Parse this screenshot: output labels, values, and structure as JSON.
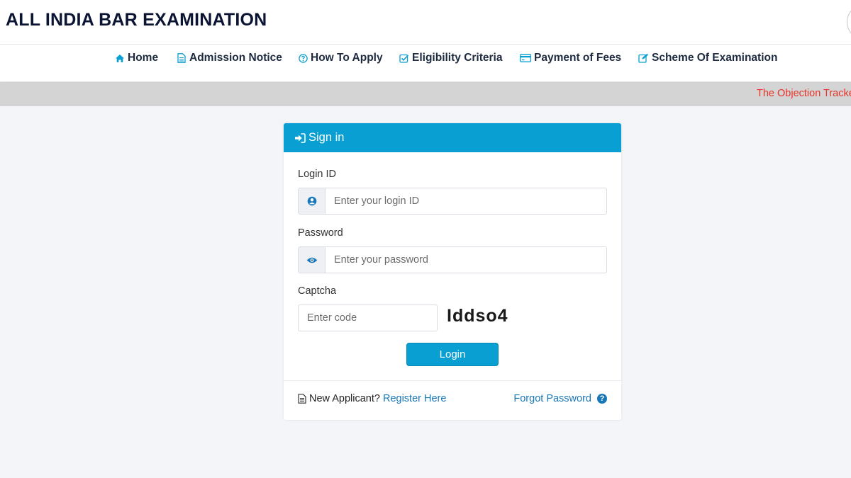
{
  "site": {
    "title": "ALL INDIA BAR EXAMINATION"
  },
  "nav": {
    "items": [
      {
        "label": "Home",
        "icon": "home-icon"
      },
      {
        "label": "Admission Notice",
        "icon": "document-icon"
      },
      {
        "label": "How To Apply",
        "icon": "question-circle-icon"
      },
      {
        "label": "Eligibility Criteria",
        "icon": "check-square-icon"
      },
      {
        "label": "Payment of Fees",
        "icon": "credit-card-icon"
      },
      {
        "label": "Scheme Of Examination",
        "icon": "edit-icon"
      }
    ]
  },
  "ticker": {
    "text": "The Objection Tracke"
  },
  "signin": {
    "title": "Sign in",
    "login_label": "Login ID",
    "login_placeholder": "Enter your login ID",
    "password_label": "Password",
    "password_placeholder": "Enter your password",
    "captcha_label": "Captcha",
    "captcha_placeholder": "Enter code",
    "captcha_code": "Iddso4",
    "login_button": "Login",
    "new_applicant_text": "New Applicant?",
    "register_link": "Register Here",
    "forgot_link": "Forgot Password"
  },
  "colors": {
    "primary": "#0a9fd2",
    "link": "#1977b8",
    "ticker_text": "#e8332a",
    "title": "#0b1433"
  }
}
